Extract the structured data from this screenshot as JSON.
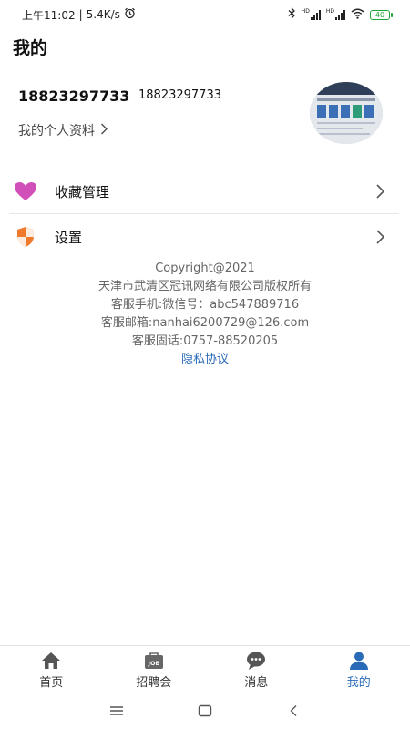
{
  "status_bar": {
    "time": "上午11:02",
    "network_speed": "5.4K/s",
    "alarm_icon": "alarm-clock-icon",
    "bluetooth_icon": "bluetooth-icon",
    "signal_labels": [
      "HD",
      "HD"
    ],
    "battery_level": "40",
    "battery_color": "#22a43a"
  },
  "header": {
    "title": "我的"
  },
  "profile": {
    "name": "18823297733",
    "phone": "18823297733",
    "personal_info_label": "我的个人资料",
    "chevron": ">"
  },
  "menu": {
    "items": [
      {
        "label": "收藏管理",
        "icon": "heart-icon",
        "icon_color": "#d14fb9"
      },
      {
        "label": "设置",
        "icon": "shield-icon",
        "icon_color": "#f07a2b"
      }
    ]
  },
  "footer_info": {
    "copyright": "Copyright@2021",
    "company": "天津市武清区冠讯网络有限公司版权所有",
    "service_phone": "客服手机:微信号：abc547889716",
    "service_email": "客服邮箱:nanhai6200729@126.com",
    "service_landline": "客服固话:0757-88520205",
    "privacy_link": "隐私协议",
    "link_color": "#2a6bb8"
  },
  "bottom_nav": {
    "items": [
      {
        "label": "首页",
        "icon": "home-icon",
        "active": false
      },
      {
        "label": "招聘会",
        "icon": "job-fair-icon",
        "active": false
      },
      {
        "label": "消息",
        "icon": "message-icon",
        "active": false
      },
      {
        "label": "我的",
        "icon": "profile-icon",
        "active": true
      }
    ],
    "active_color": "#2a6bb8"
  },
  "system_nav": {
    "menu_icon": "menu-icon",
    "home_icon": "home-square-icon",
    "back_icon": "back-icon"
  }
}
